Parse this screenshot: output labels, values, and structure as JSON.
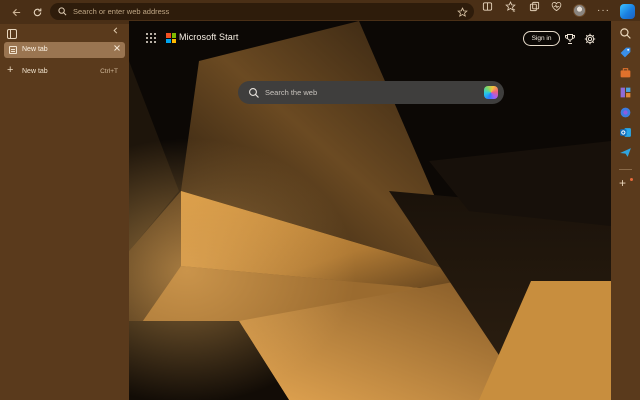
{
  "toolbar": {
    "address_placeholder": "Search or enter web address"
  },
  "tabs": {
    "active_tab_label": "New tab",
    "new_tab_label": "New tab",
    "new_tab_shortcut": "Ctrl+T"
  },
  "header": {
    "brand": "Microsoft Start",
    "signin_label": "Sign in"
  },
  "search": {
    "placeholder": "Search the web"
  },
  "sidebar": {
    "items": [
      "search-icon",
      "shopping-tag-icon",
      "toolbox-icon",
      "games-icon",
      "copilot-icon",
      "outlook-icon",
      "send-icon"
    ]
  },
  "colors": {
    "frame": "#5a3a1c",
    "toolbar": "#4a2f16",
    "active_tab": "#9a7551",
    "background_dark": "#0c0805",
    "background_gold": "#c88e3e"
  }
}
